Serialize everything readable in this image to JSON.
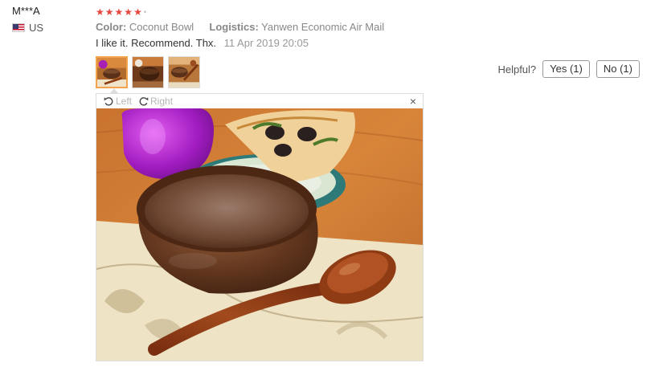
{
  "reviewer": {
    "name": "M***A",
    "country": "US",
    "flag_icon": "us-flag-icon"
  },
  "review": {
    "rating": 5,
    "stars": [
      "★",
      "★",
      "★",
      "★",
      "★"
    ],
    "star_color": "#e5473c",
    "color_label": "Color:",
    "color_value": "Coconut Bowl",
    "logistics_label": "Logistics:",
    "logistics_value": "Yanwen Economic Air Mail",
    "text": "I like it. Recommend. Thx.",
    "date": "11 Apr 2019 20:05"
  },
  "photos": {
    "thumbnails": [
      {
        "name": "photo-thumbnail-1",
        "selected": true
      },
      {
        "name": "photo-thumbnail-2",
        "selected": false
      },
      {
        "name": "photo-thumbnail-3",
        "selected": false
      }
    ],
    "selected_border_color": "#f2a34e"
  },
  "helpful": {
    "label": "Helpful?",
    "yes_label": "Yes (1)",
    "no_label": "No (1)"
  },
  "viewer": {
    "rotate_left_label": "Left",
    "rotate_right_label": "Right",
    "rotate_left_icon": "rotate-left-icon",
    "rotate_right_icon": "rotate-right-icon",
    "close_icon": "close-icon",
    "close_symbol": "×"
  }
}
